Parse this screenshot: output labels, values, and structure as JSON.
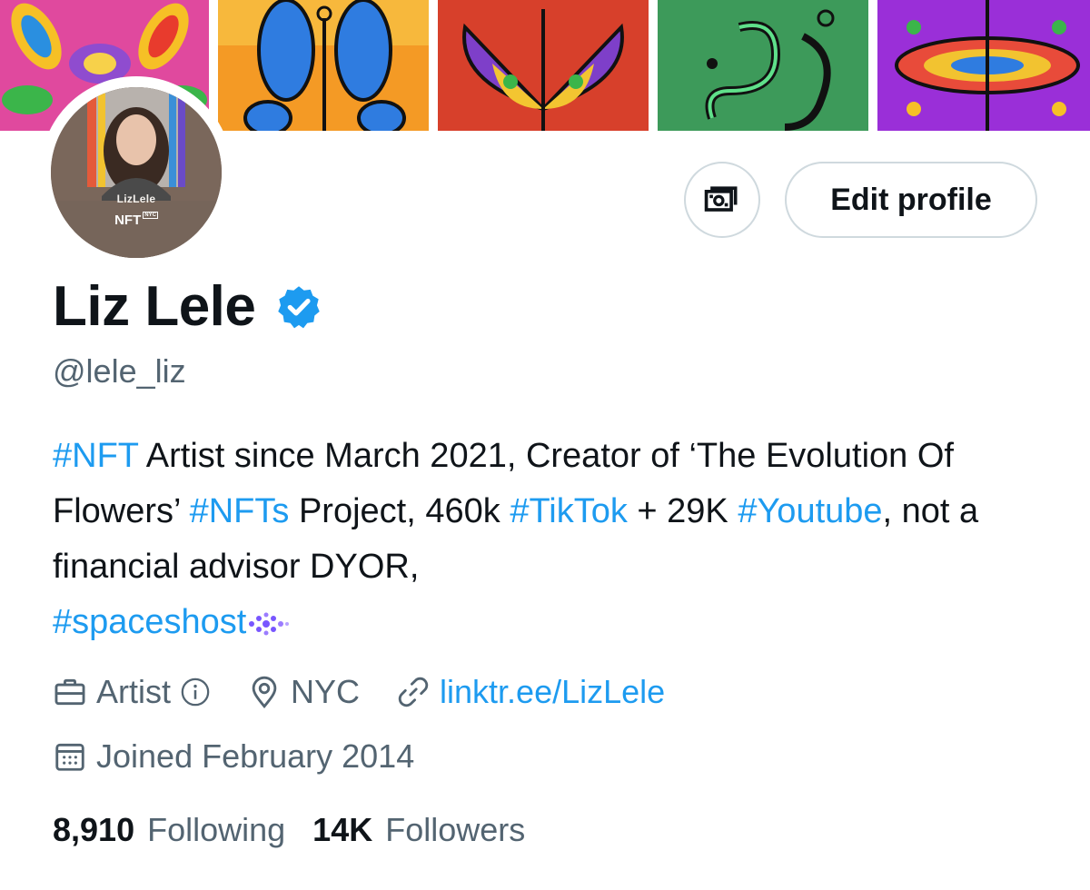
{
  "profile": {
    "display_name": "Liz Lele",
    "handle": "@lele_liz",
    "avatar": {
      "overlay_name": "LizLele",
      "overlay_badge": "NFT",
      "overlay_badge_sup": "NYC"
    },
    "edit_profile_label": "Edit profile",
    "bio": {
      "tag1": "#NFT",
      "text1": " Artist since March 2021, Creator of ‘The Evolution Of Flowers’ ",
      "tag2": "#NFTs",
      "text2": " Project, 460k ",
      "tag3": "#TikTok",
      "text3": " + 29K ",
      "tag4": "#Youtube",
      "text4": ", not a financial advisor DYOR, ",
      "tag5": "#spaceshost"
    },
    "profession": "Artist",
    "location": "NYC",
    "link": "linktr.ee/LizLele",
    "joined": "Joined February 2014",
    "following_count": "8,910",
    "following_label": "Following",
    "followers_count": "14K",
    "followers_label": "Followers"
  },
  "colors": {
    "accent": "#1d9bf0",
    "secondary_text": "#536471",
    "primary_text": "#0f1419",
    "border": "#cfd9de"
  },
  "icons": {
    "tip": "money-icon",
    "verified": "verified-badge-icon",
    "profession": "briefcase-icon",
    "info": "info-icon",
    "location": "location-pin-icon",
    "link": "link-icon",
    "joined": "calendar-icon"
  }
}
